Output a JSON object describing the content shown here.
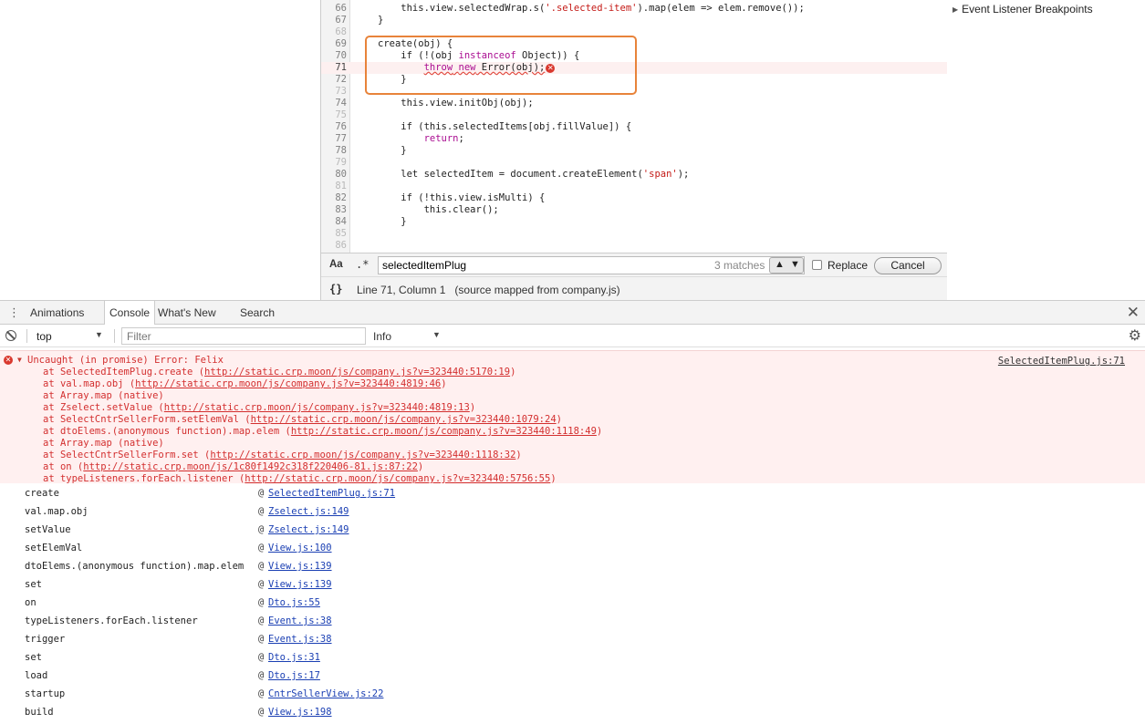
{
  "breakpoints": {
    "event_listener": "Event Listener Breakpoints"
  },
  "code": [
    {
      "n": "66",
      "html": "    this.view.selectedWrap.s(<span class=\"str\">'.selected-item'</span>).map(elem => elem.remove());"
    },
    {
      "n": "67",
      "html": "}"
    },
    {
      "n": "68",
      "html": ""
    },
    {
      "n": "69",
      "html": "create(obj) {"
    },
    {
      "n": "70",
      "html": "    if (!(obj <span class=\"kw\">instanceof</span> Object)) {"
    },
    {
      "n": "71",
      "html": "        <span class=\"err-underline\"><span class=\"kw\">throw</span> <span class=\"kw\">new</span> Error(obj);</span><span class=\"err-dot\">✕</span>",
      "error": true
    },
    {
      "n": "72",
      "html": "    }"
    },
    {
      "n": "73",
      "html": ""
    },
    {
      "n": "74",
      "html": "    this.view.initObj(obj);"
    },
    {
      "n": "75",
      "html": ""
    },
    {
      "n": "76",
      "html": "    if (this.selectedItems[obj.fillValue]) {"
    },
    {
      "n": "77",
      "html": "        <span class=\"kw\">return</span>;"
    },
    {
      "n": "78",
      "html": "    }"
    },
    {
      "n": "79",
      "html": ""
    },
    {
      "n": "80",
      "html": "    let selectedItem = document.createElement(<span class=\"str\">'span'</span>);"
    },
    {
      "n": "81",
      "html": ""
    },
    {
      "n": "82",
      "html": "    if (!this.view.isMulti) {"
    },
    {
      "n": "83",
      "html": "        this.clear();"
    },
    {
      "n": "84",
      "html": "    }"
    },
    {
      "n": "85",
      "html": ""
    },
    {
      "n": "86",
      "html": ""
    }
  ],
  "search": {
    "case_label": "Aa",
    "regex_label": ".*",
    "value": "selectedItemPlug",
    "match_count": "3 matches",
    "replace_label": "Replace",
    "cancel_label": "Cancel"
  },
  "status": {
    "braces": "{}",
    "position": "Line 71, Column 1",
    "source_map": "(source mapped from company.js)"
  },
  "drawer": {
    "tabs": [
      "Animations",
      "Console",
      "What's New",
      "Search"
    ],
    "active_tab": "Console"
  },
  "console_toolbar": {
    "context": "top",
    "filter_placeholder": "Filter",
    "level": "Info"
  },
  "error": {
    "message": "Uncaught (in promise) Error: Felix",
    "source": "SelectedItemPlug.js:71",
    "trace": [
      {
        "fn": "at SelectedItemPlug.create",
        "url": "http://static.crp.moon/js/company.js?v=323440:5170:19"
      },
      {
        "fn": "at val.map.obj",
        "url": "http://static.crp.moon/js/company.js?v=323440:4819:46"
      },
      {
        "fn": "at Array.map (native)",
        "url": ""
      },
      {
        "fn": "at Zselect.setValue",
        "url": "http://static.crp.moon/js/company.js?v=323440:4819:13"
      },
      {
        "fn": "at SelectCntrSellerForm.setElemVal",
        "url": "http://static.crp.moon/js/company.js?v=323440:1079:24"
      },
      {
        "fn": "at dtoElems.(anonymous function).map.elem",
        "url": "http://static.crp.moon/js/company.js?v=323440:1118:49"
      },
      {
        "fn": "at Array.map (native)",
        "url": ""
      },
      {
        "fn": "at SelectCntrSellerForm.set",
        "url": "http://static.crp.moon/js/company.js?v=323440:1118:32"
      },
      {
        "fn": "at on",
        "url": "http://static.crp.moon/js/1c80f1492c318f220406-81.js:87:22"
      },
      {
        "fn": "at typeListeners.forEach.listener",
        "url": "http://static.crp.moon/js/company.js?v=323440:5756:55"
      }
    ]
  },
  "stack": [
    {
      "fn": "create",
      "src": "SelectedItemPlug.js:71"
    },
    {
      "fn": "val.map.obj",
      "src": "Zselect.js:149"
    },
    {
      "fn": "setValue",
      "src": "Zselect.js:149"
    },
    {
      "fn": "setElemVal",
      "src": "View.js:100"
    },
    {
      "fn": "dtoElems.(anonymous function).map.elem",
      "src": "View.js:139"
    },
    {
      "fn": "set",
      "src": "View.js:139"
    },
    {
      "fn": "on",
      "src": "Dto.js:55"
    },
    {
      "fn": "typeListeners.forEach.listener",
      "src": "Event.js:38"
    },
    {
      "fn": "trigger",
      "src": "Event.js:38"
    },
    {
      "fn": "set",
      "src": "Dto.js:31"
    },
    {
      "fn": "load",
      "src": "Dto.js:17"
    },
    {
      "fn": "startup",
      "src": "CntrSellerView.js:22"
    },
    {
      "fn": "build",
      "src": "View.js:198"
    }
  ]
}
